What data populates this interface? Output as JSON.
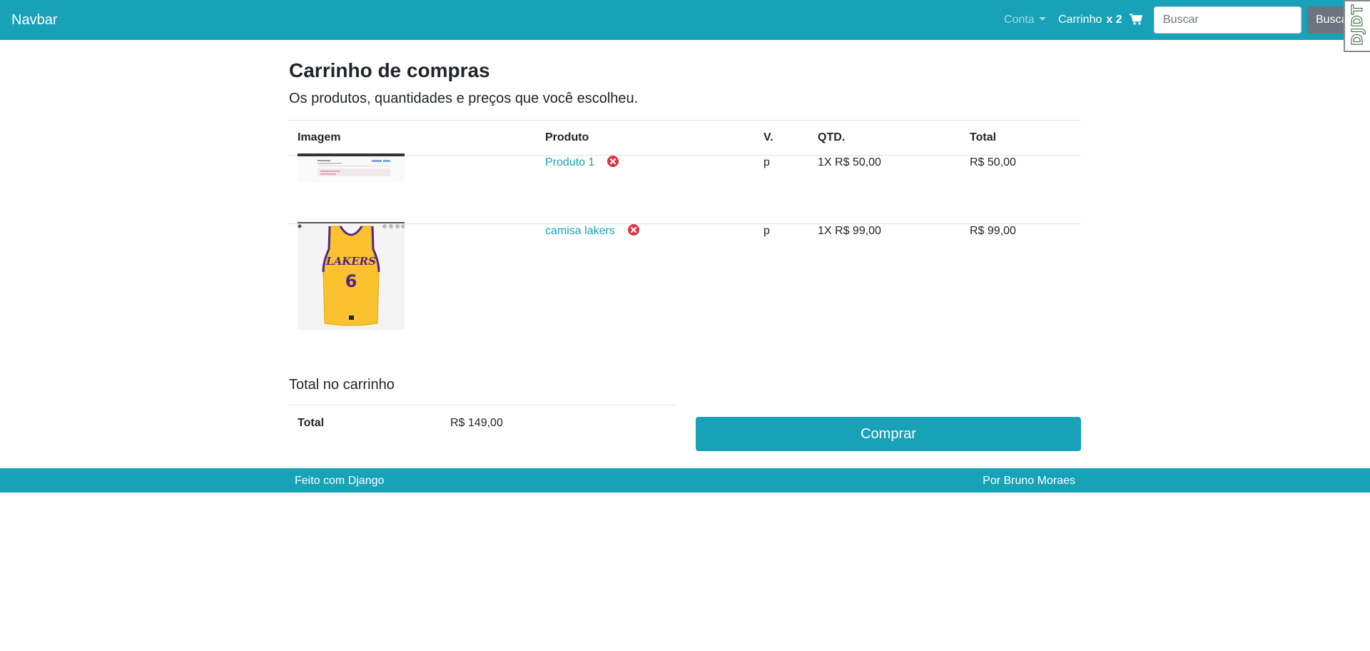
{
  "navbar": {
    "brand": "Navbar",
    "account_label": "Conta",
    "cart_label": "Carrinho",
    "cart_count": "x 2",
    "search_placeholder": "Buscar",
    "search_button": "Buscar",
    "debug_toolbar_label": "DJDT"
  },
  "page": {
    "title": "Carrinho de compras",
    "subtitle": "Os produtos, quantidades e preços que você escolheu."
  },
  "cart_table": {
    "headers": [
      "Imagem",
      "Produto",
      "V.",
      "QTD.",
      "Total"
    ],
    "rows": [
      {
        "product": "Produto 1",
        "variation": "p",
        "quantity": "1X R$ 50,00",
        "total": "R$ 50,00"
      },
      {
        "product": "camisa lakers",
        "variation": "p",
        "quantity": "1X R$ 99,00",
        "total": "R$ 99,00"
      }
    ]
  },
  "totals": {
    "heading": "Total no carrinho",
    "label": "Total",
    "value": "R$ 149,00"
  },
  "buy_button": "Comprar",
  "footer": {
    "left": "Feito com Django",
    "right": "Por Bruno Moraes"
  },
  "colors": {
    "primary": "#17a2b8",
    "danger": "#dc3545",
    "secondary": "#6c757d"
  }
}
